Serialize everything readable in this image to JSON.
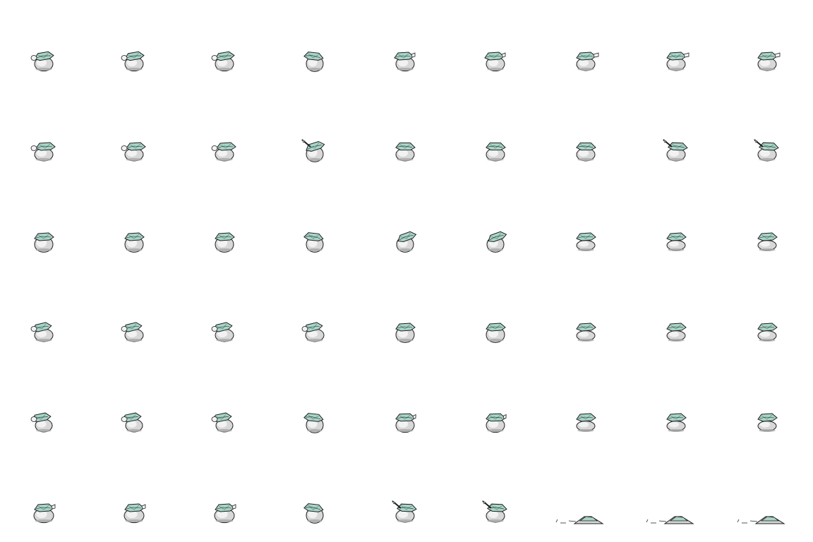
{
  "sprite_sheet": {
    "background": "#ffffff",
    "columns": 9,
    "rows": 6,
    "colors": {
      "body_light": "#f2f2f2",
      "body_mid": "#d8d8d8",
      "body_shade": "#a8a8a8",
      "teal": "#a9d4c8",
      "teal_dark": "#6a9c8f",
      "outline": "#1e1e1e"
    },
    "frames": [
      [
        "idle-a",
        "idle-a",
        "idle-a",
        "turn",
        "reach",
        "reach",
        "look-right",
        "look-right",
        "look-right"
      ],
      [
        "look-left",
        "look-left",
        "look-left",
        "raise",
        "hunch",
        "hunch",
        "hunch",
        "swipe",
        "swipe"
      ],
      [
        "stand",
        "stand",
        "stand",
        "turn",
        "lean",
        "lean",
        "crouch",
        "crouch",
        "crouch"
      ],
      [
        "twist",
        "twist",
        "twist",
        "twist",
        "stand",
        "stand",
        "crouch",
        "crouch",
        "crouch"
      ],
      [
        "side",
        "side",
        "side",
        "turn",
        "wave",
        "wave",
        "crouch",
        "crouch",
        "crouch"
      ],
      [
        "wide",
        "wide",
        "wide",
        "turn",
        "swipe",
        "swipe",
        "flat",
        "flat",
        "flat"
      ]
    ]
  }
}
